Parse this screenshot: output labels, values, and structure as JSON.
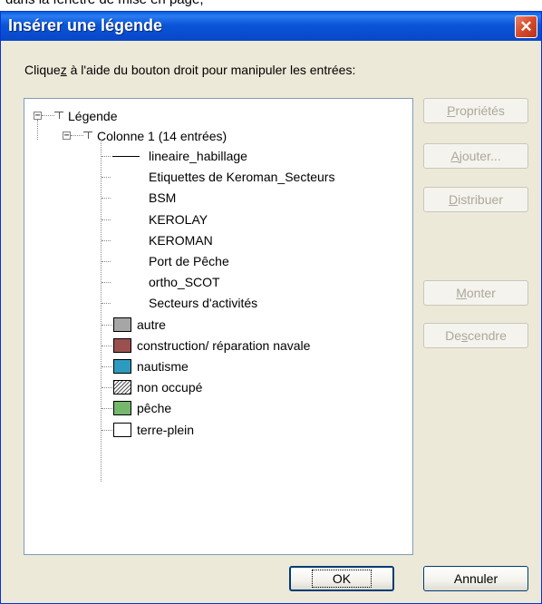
{
  "doc_fragment": "dans la fenêtre de mise en page,",
  "dialog": {
    "title": "Insérer une légende",
    "close_glyph": "✕",
    "instruction_prefix": "Clique",
    "instruction_accel": "z",
    "instruction_suffix": " à l'aide du bouton droit pour manipuler les entrées:"
  },
  "tree": {
    "root_label": "Légende",
    "column_label": "Colonne 1 (14 entrées)",
    "layers": [
      {
        "label": "lineaire_habillage",
        "symbol": "line-icon"
      },
      {
        "label": "Etiquettes de Keroman_Secteurs",
        "symbol": ""
      },
      {
        "label": "BSM",
        "symbol": ""
      },
      {
        "label": "KEROLAY",
        "symbol": ""
      },
      {
        "label": "KEROMAN",
        "symbol": ""
      },
      {
        "label": "Port de Pêche",
        "symbol": ""
      },
      {
        "label": "ortho_SCOT",
        "symbol": ""
      },
      {
        "label": "Secteurs d'activités",
        "symbol": ""
      }
    ],
    "classes": [
      {
        "label": "autre",
        "color": "#a6a6a6",
        "pattern": "solid"
      },
      {
        "label": "construction/ réparation navale",
        "color": "#9b5050",
        "pattern": "solid"
      },
      {
        "label": "nautisme",
        "color": "#2d9bc0",
        "pattern": "solid"
      },
      {
        "label": "non occupé",
        "color": "#ffffff",
        "pattern": "hatched"
      },
      {
        "label": "pêche",
        "color": "#74b86e",
        "pattern": "solid"
      },
      {
        "label": "terre-plein",
        "color": "#ffffff",
        "pattern": "solid"
      }
    ]
  },
  "buttons": {
    "properties": {
      "pre": "",
      "accel": "P",
      "post": "ropriétés"
    },
    "add": {
      "pre": "",
      "accel": "A",
      "post": "jouter..."
    },
    "distribute": {
      "pre": "",
      "accel": "D",
      "post": "istribuer"
    },
    "move_up": {
      "pre": "",
      "accel": "M",
      "post": "onter"
    },
    "move_down": {
      "pre": "De",
      "accel": "s",
      "post": "cendre"
    },
    "ok": "OK",
    "cancel": "Annuler"
  },
  "colors": {
    "titlebar": "#0a55d8",
    "dialog_bg": "#ece9d8",
    "close": "#d64a2a",
    "disabled_text": "#aca899"
  }
}
